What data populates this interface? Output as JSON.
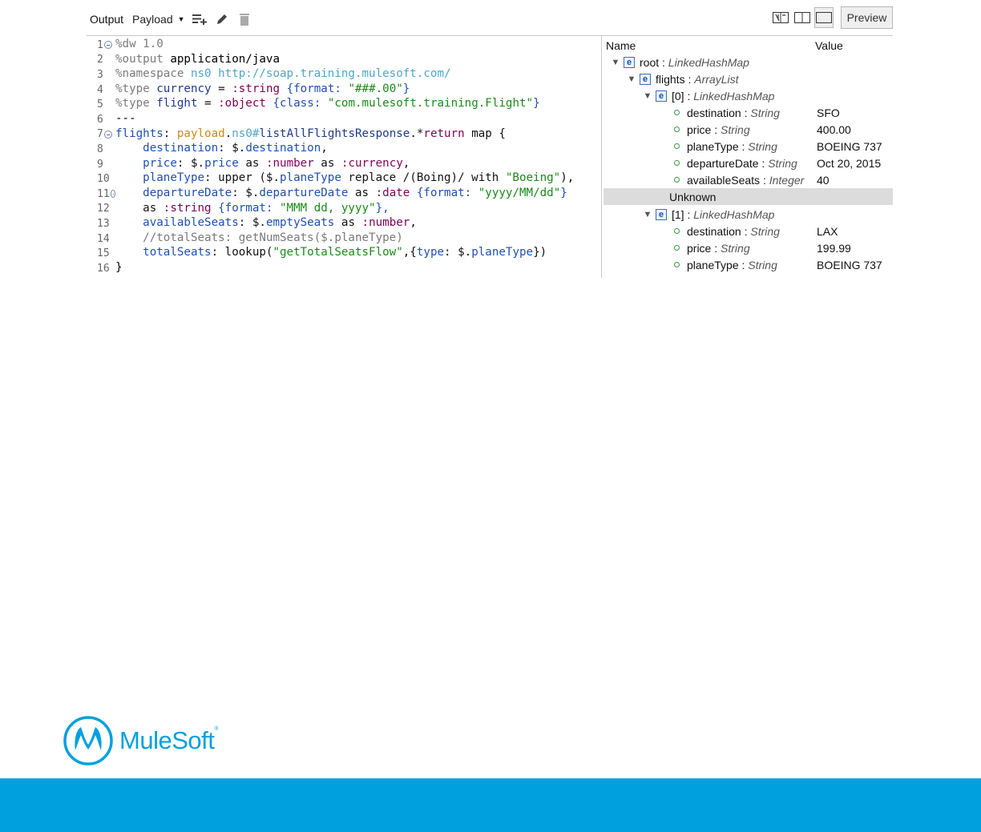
{
  "toolbar": {
    "output_label": "Output",
    "payload_label": "Payload",
    "icons": [
      "add-list-icon",
      "pencil-icon",
      "trash-icon"
    ],
    "view_modes": [
      "split-diagram-icon",
      "split-columns-icon",
      "single-panel-icon"
    ],
    "preview_label": "Preview"
  },
  "editor": {
    "line_numbers": [
      "1",
      "2",
      "3",
      "4",
      "5",
      "6",
      "7",
      "8",
      "9",
      "10",
      "11",
      "12",
      "13",
      "14",
      "15",
      "16"
    ],
    "lines": [
      [
        "%dw 1.0"
      ],
      [
        "%output",
        " application/java"
      ],
      [
        "%namespace",
        " ",
        "ns0",
        " ",
        "http://soap.training.mulesoft.com/"
      ],
      [
        "%type",
        " ",
        "currency",
        " = ",
        ":string",
        " ",
        "{format: ",
        "\"###.00\"",
        "}"
      ],
      [
        "%type",
        " ",
        "flight",
        " = ",
        ":object",
        " ",
        "{class: ",
        "\"com.mulesoft.training.Flight\"",
        "}"
      ],
      [
        "---"
      ],
      [
        "flights",
        ": ",
        "payload",
        ".",
        "ns0#",
        "listAllFlightsResponse",
        ".*",
        "return",
        " map {"
      ],
      [
        "    ",
        "destination",
        ": $.",
        "destination",
        ","
      ],
      [
        "    ",
        "price",
        ": $.",
        "price",
        " as ",
        ":number",
        " as ",
        ":currency",
        ","
      ],
      [
        "    ",
        "planeType",
        ": upper ($.",
        "planeType",
        " replace /(Boing)/ with ",
        "\"Boeing\"",
        "),"
      ],
      [
        "    ",
        "departureDate",
        ": $.",
        "departureDate",
        " as ",
        ":date",
        " ",
        "{format: ",
        "\"yyyy/MM/dd\"",
        "}"
      ],
      [
        "    as ",
        ":string",
        " ",
        "{format: ",
        "\"MMM dd, yyyy\"",
        "},"
      ],
      [
        "    ",
        "availableSeats",
        ": $.",
        "emptySeats",
        " as ",
        ":number",
        ","
      ],
      [
        "    ",
        "//totalSeats: getNumSeats($.planeType)"
      ],
      [
        "    ",
        "totalSeats",
        ": lookup(",
        "\"getTotalSeatsFlow\"",
        ",{",
        "type",
        ": $.",
        "planeType",
        "})"
      ],
      [
        "}"
      ]
    ]
  },
  "tree": {
    "header_name": "Name",
    "header_value": "Value",
    "rows": [
      {
        "name": "root",
        "type": "LinkedHashMap",
        "value": ""
      },
      {
        "name": "flights",
        "type": "ArrayList",
        "value": ""
      },
      {
        "name": "[0]",
        "type": "LinkedHashMap",
        "value": ""
      },
      {
        "name": "destination",
        "type": "String",
        "value": "SFO"
      },
      {
        "name": "price",
        "type": "String",
        "value": "400.00"
      },
      {
        "name": "planeType",
        "type": "String",
        "value": "BOEING 737"
      },
      {
        "name": "departureDate",
        "type": "String",
        "value": "Oct 20, 2015"
      },
      {
        "name": "availableSeats",
        "type": "Integer",
        "value": "40"
      },
      {
        "name": "Unknown",
        "type": "",
        "value": ""
      },
      {
        "name": "[1]",
        "type": "LinkedHashMap",
        "value": ""
      },
      {
        "name": "destination",
        "type": "String",
        "value": "LAX"
      },
      {
        "name": "price",
        "type": "String",
        "value": "199.99"
      },
      {
        "name": "planeType",
        "type": "String",
        "value": "BOEING 737"
      }
    ]
  },
  "branding": {
    "name": "MuleSoft",
    "trademark": "®",
    "logo_icon": "mulesoft-m-icon",
    "accent_color": "#00a0df"
  }
}
